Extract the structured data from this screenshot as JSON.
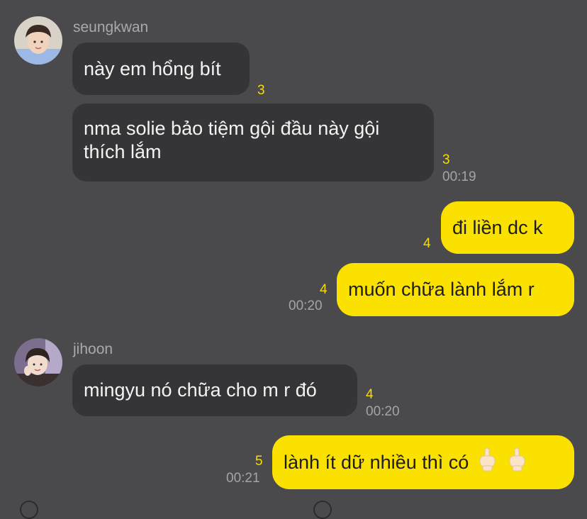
{
  "theme": {
    "background": "#4a4a4c",
    "incoming_bubble": "#353537",
    "outgoing_bubble": "#fae100",
    "unread_count": "#f8dc00"
  },
  "messages": {
    "group1": {
      "sender": "seungkwan",
      "msg1": {
        "text": "này em hổng bít",
        "count": "3"
      },
      "msg2": {
        "text_line1": "nma solie bảo tiệm gội đầu này gội",
        "text_line2": "thích lắm",
        "count": "3",
        "time": "00:19"
      }
    },
    "group2": {
      "msg1": {
        "text": "đi liền dc k",
        "count": "4"
      },
      "msg2": {
        "text": "muốn chữa lành lắm r",
        "count": "4",
        "time": "00:20"
      }
    },
    "group3": {
      "sender": "jihoon",
      "msg1": {
        "text": "mingyu nó chữa cho m r đó",
        "count": "4",
        "time": "00:20"
      }
    },
    "group4": {
      "msg1": {
        "text": "lành ít dữ nhiều thì có",
        "emoji": "middle-finger-emoji",
        "count": "5",
        "time": "00:21"
      }
    }
  }
}
